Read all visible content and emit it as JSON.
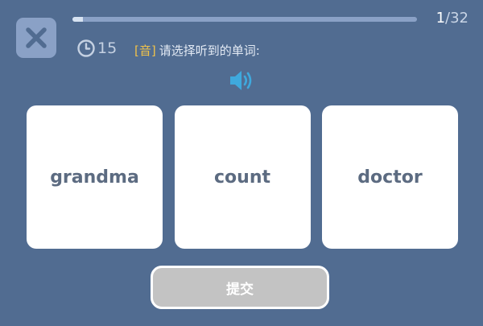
{
  "progress": {
    "current": "1",
    "separator": "/",
    "total": "32",
    "fraction": 0.03
  },
  "timer": {
    "icon": "clock-icon",
    "seconds": "15"
  },
  "prompt": {
    "tag": "[音]",
    "text": "请选择听到的单词:"
  },
  "audio": {
    "icon": "speaker-icon"
  },
  "close": {
    "icon": "close-icon"
  },
  "options": [
    {
      "word": "grandma"
    },
    {
      "word": "count"
    },
    {
      "word": "doctor"
    }
  ],
  "submit": {
    "label": "提交"
  },
  "colors": {
    "background": "#516c91",
    "accent_tag": "#f0c24a",
    "speaker": "#3fa9dd",
    "submit_disabled": "#c3c3c3"
  }
}
